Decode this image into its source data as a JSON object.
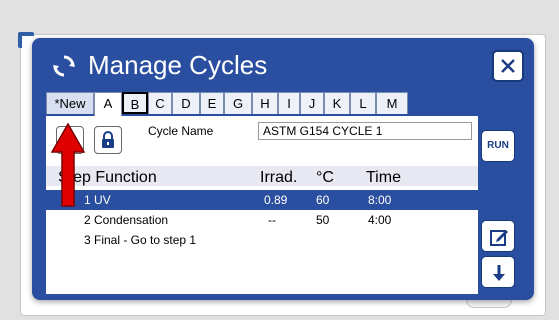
{
  "dialog": {
    "title": "Manage Cycles",
    "run_label": "RUN"
  },
  "tabs": [
    "*New",
    "A",
    "B",
    "C",
    "D",
    "E",
    "G",
    "H",
    "I",
    "J",
    "K",
    "L",
    "M"
  ],
  "cycle_name": {
    "label": "Cycle Name",
    "value": "ASTM G154 CYCLE 1"
  },
  "table": {
    "headers": [
      "Step Function",
      "Irrad.",
      "°C",
      "Time"
    ],
    "rows": [
      {
        "step": "1 UV",
        "irrad": "0.89",
        "temp": "60",
        "time": "8:00"
      },
      {
        "step": "2 Condensation",
        "irrad": "--",
        "temp": "50",
        "time": "4:00"
      },
      {
        "step": "3 Final - Go to step 1",
        "irrad": "",
        "temp": "",
        "time": ""
      }
    ]
  },
  "colors": {
    "dialog_blue": "#2b4fa0",
    "selection_blue": "#2b4fa0",
    "annotation_arrow": "#e00000"
  },
  "icons": [
    "refresh-icon",
    "close-icon",
    "lock-icon",
    "edit-icon",
    "arrow-down-icon",
    "red-arrow-annotation"
  ]
}
